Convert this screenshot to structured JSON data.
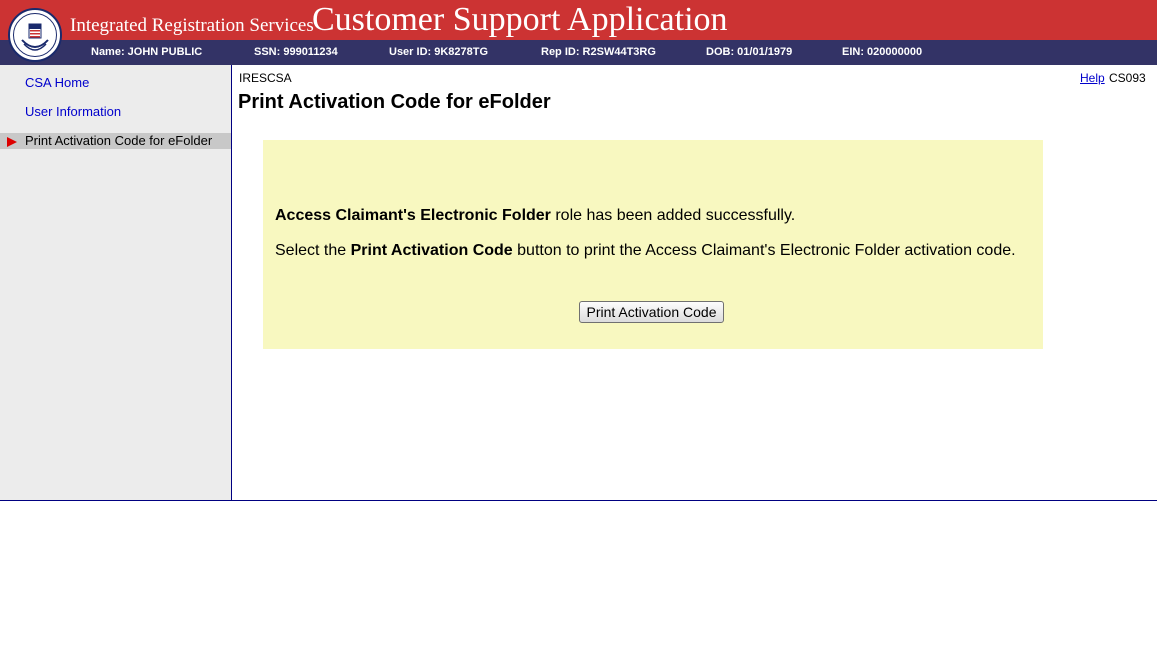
{
  "header": {
    "org_title": "Integrated Registration Services",
    "app_title": "Customer Support Application",
    "seal_text": "SOCIAL SECURITY ADMINISTRATION USA"
  },
  "infobar": {
    "name": "Name: JOHN PUBLIC",
    "ssn": "SSN: 999011234",
    "user_id": "User ID: 9K8278TG",
    "rep_id": "Rep ID: R2SW44T3RG",
    "dob": "DOB: 01/01/1979",
    "ein": "EIN: 020000000"
  },
  "sidebar": {
    "items": [
      {
        "label": "CSA Home"
      },
      {
        "label": "User Information"
      },
      {
        "label": "Print Activation Code for eFolder"
      }
    ]
  },
  "main": {
    "breadcrumb": "IRESCSA",
    "help_link": "Help",
    "page_code": "CS093",
    "title": "Print Activation Code for eFolder",
    "message1": {
      "bold": "Access Claimant's Electronic Folder",
      "rest": " role has been added successfully."
    },
    "message2": {
      "pre": "Select the ",
      "bold": "Print Activation Code",
      "post": " button to print the Access Claimant's Electronic Folder activation code."
    },
    "button_label": "Print Activation Code"
  },
  "colors": {
    "header_red": "#cc3333",
    "infobar_blue": "#333366",
    "panel_yellow": "#f8f8c0",
    "link_blue": "#0000cc"
  }
}
